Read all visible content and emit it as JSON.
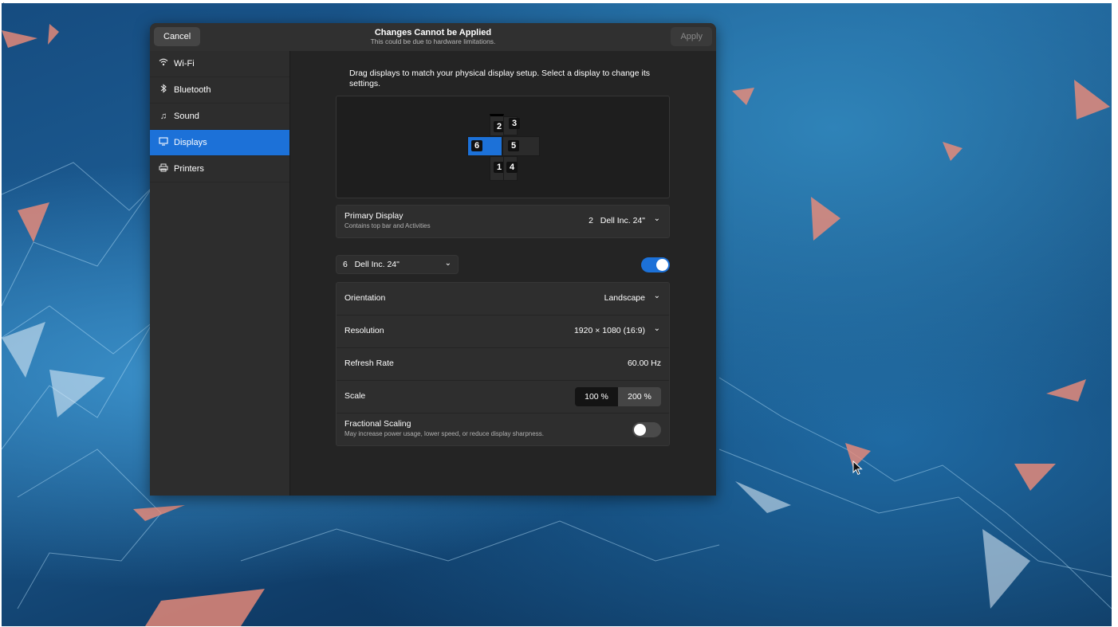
{
  "corner_label": "1",
  "header": {
    "cancel_label": "Cancel",
    "apply_label": "Apply",
    "title": "Changes Cannot be Applied",
    "subtitle": "This could be due to hardware limitations."
  },
  "sidebar": {
    "items": [
      {
        "label": "Wi-Fi",
        "icon": "wifi-icon"
      },
      {
        "label": "Bluetooth",
        "icon": "bluetooth-icon"
      },
      {
        "label": "Sound",
        "icon": "music-note-icon"
      },
      {
        "label": "Displays",
        "icon": "display-icon",
        "active": true
      },
      {
        "label": "Printers",
        "icon": "printer-icon"
      }
    ]
  },
  "displays": {
    "intro": "Drag displays to match your physical display setup. Select a display to change its settings.",
    "monitors": [
      "2",
      "3",
      "6",
      "5",
      "1",
      "4"
    ],
    "selected_monitor": "6",
    "primary": {
      "label": "Primary Display",
      "sublabel": "Contains top bar and Activities",
      "value": "2   Dell Inc. 24\""
    },
    "selector": {
      "value": "6   Dell Inc. 24\"",
      "enabled": true
    },
    "settings": {
      "orientation_label": "Orientation",
      "orientation_value": "Landscape",
      "resolution_label": "Resolution",
      "resolution_value": "1920 × 1080 (16:9)",
      "refresh_label": "Refresh Rate",
      "refresh_value": "60.00 Hz",
      "scale_label": "Scale",
      "scale_options": [
        "100 %",
        "200 %"
      ],
      "scale_selected": "100 %",
      "fractional_label": "Fractional Scaling",
      "fractional_sub": "May increase power usage, lower speed, or reduce display sharpness.",
      "fractional_enabled": false
    }
  },
  "colors": {
    "accent": "#1c71d8",
    "window_bg": "#242424",
    "sidebar_bg": "#2d2d2d"
  }
}
